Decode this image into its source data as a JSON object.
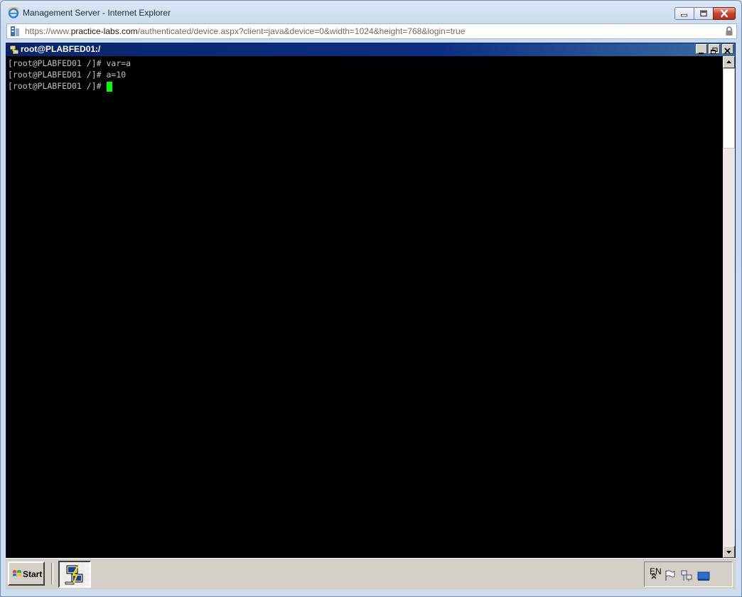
{
  "browser": {
    "title": "Management Server - Internet Explorer",
    "url_scheme": "https://www.",
    "url_host": "practice-labs.com",
    "url_path": "/authenticated/device.aspx?client=java&device=0&width=1024&height=768&login=true",
    "icons": {
      "logo": "ie-logo-icon",
      "page": "page-icon",
      "lock": "lock-icon",
      "minimize": "minimize-icon",
      "maximize": "maximize-icon",
      "close": "close-icon"
    }
  },
  "terminal": {
    "title": "root@PLABFED01:/",
    "lines": [
      "[root@PLABFED01 /]# var=a",
      "[root@PLABFED01 /]# a=10",
      "[root@PLABFED01 /]#"
    ],
    "cursor_color": "#00ff00",
    "text_color": "#c0c0c0",
    "background": "#000000"
  },
  "taskbar": {
    "start_label": "Start",
    "language": "EN",
    "tray_icons": [
      "chevron-up-icon",
      "flag-icon",
      "network-icon",
      "display-icon"
    ]
  }
}
